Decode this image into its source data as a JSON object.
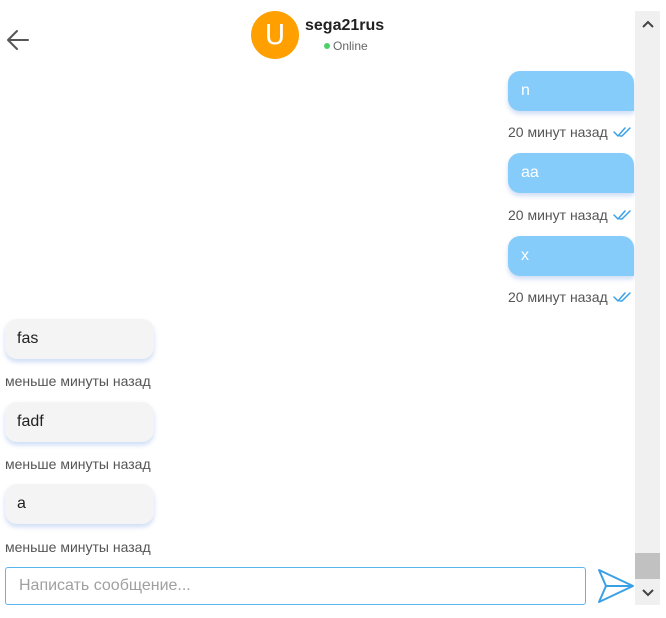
{
  "header": {
    "avatar_letter": "U",
    "avatar_color": "#ffa000",
    "username": "sega21rus",
    "status": "Online",
    "status_color": "#4cd06a",
    "back_icon": "arrow-left-icon"
  },
  "messages": [
    {
      "direction": "out",
      "text": "n",
      "time": "20 минут назад",
      "read": true
    },
    {
      "direction": "out",
      "text": "aa",
      "time": "20 минут назад",
      "read": true
    },
    {
      "direction": "out",
      "text": "x",
      "time": "20 минут назад",
      "read": true
    },
    {
      "direction": "in",
      "text": "fas",
      "time": "меньше минуты назад"
    },
    {
      "direction": "in",
      "text": "fadf",
      "time": "меньше минуты назад"
    },
    {
      "direction": "in",
      "text": "a",
      "time": "меньше минуты назад"
    }
  ],
  "composer": {
    "placeholder": "Написать сообщение...",
    "value": "",
    "send_icon": "paper-plane-icon"
  },
  "colors": {
    "outgoing_bubble": "#86ccfb",
    "incoming_bubble": "#f4f4f5",
    "accent": "#5ab7ee"
  }
}
